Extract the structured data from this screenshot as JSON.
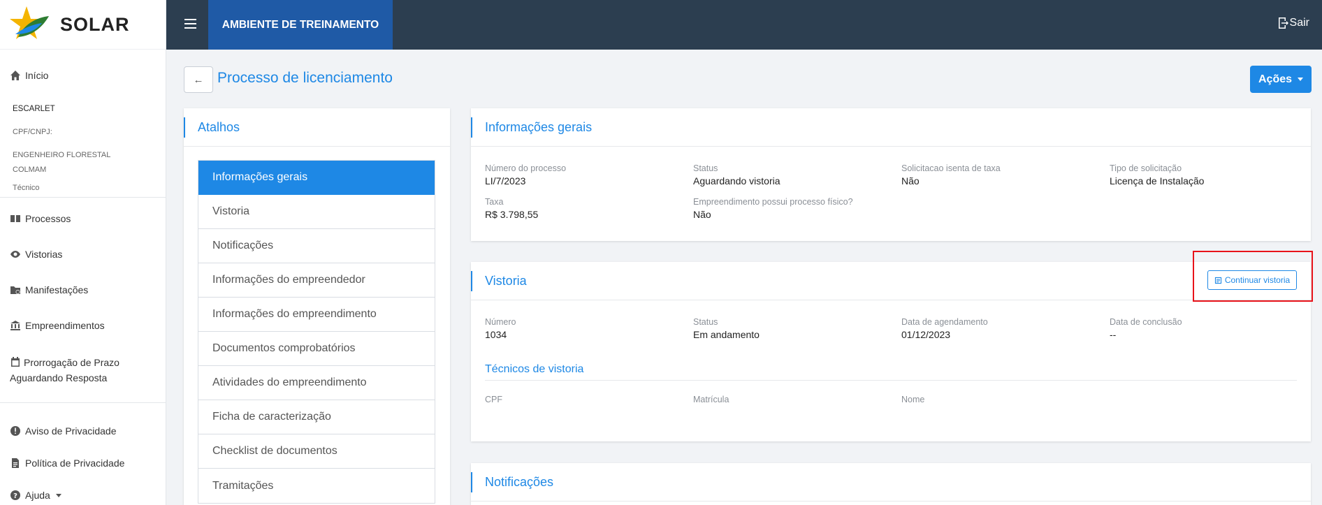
{
  "app": {
    "logo_text": "SOLAR"
  },
  "topbar": {
    "environment": "AMBIENTE DE TREINAMENTO",
    "logout_label": "Sair"
  },
  "sidebar": {
    "home": "Início",
    "user": {
      "name": "ESCARLET",
      "document": "CPF/CNPJ:",
      "role_line1": "ENGENHEIRO FLORESTAL",
      "role_line2": "COLMAM",
      "profile": "Técnico"
    },
    "items": [
      "Processos",
      "Vistorias",
      "Manifestações",
      "Empreendimentos"
    ],
    "extension_item": {
      "line1": "Prorrogação de Prazo",
      "line2": "Aguardando Resposta"
    },
    "footer": {
      "privacy_notice": "Aviso de Privacidade",
      "privacy_policy": "Política de Privacidade",
      "help": "Ajuda"
    }
  },
  "page": {
    "title": "Processo de licenciamento",
    "actions_label": "Ações"
  },
  "shortcuts": {
    "title": "Atalhos",
    "items": [
      "Informações gerais",
      "Vistoria",
      "Notificações",
      "Informações do empreendedor",
      "Informações do empreendimento",
      "Documentos comprobatórios",
      "Atividades do empreendimento",
      "Ficha de caracterização",
      "Checklist de documentos",
      "Tramitações"
    ],
    "active_index": 0
  },
  "general_info": {
    "title": "Informações gerais",
    "fields": [
      {
        "label": "Número do processo",
        "value": "LI/7/2023"
      },
      {
        "label": "Status",
        "value": "Aguardando vistoria"
      },
      {
        "label": "Solicitacao isenta de taxa",
        "value": "Não"
      },
      {
        "label": "Tipo de solicitação",
        "value": "Licença de Instalação"
      },
      {
        "label": "Taxa",
        "value": "R$ 3.798,55"
      },
      {
        "label": "Empreendimento possui processo físico?",
        "value": "Não"
      }
    ]
  },
  "inspection": {
    "title": "Vistoria",
    "continue_label": "Continuar vistoria",
    "fields": [
      {
        "label": "Número",
        "value": "1034"
      },
      {
        "label": "Status",
        "value": "Em andamento"
      },
      {
        "label": "Data de agendamento",
        "value": "01/12/2023"
      },
      {
        "label": "Data de conclusão",
        "value": "--"
      }
    ],
    "technicians_title": "Técnicos de vistoria",
    "technicians_columns": [
      "CPF",
      "Matrícula",
      "Nome"
    ]
  },
  "notifications": {
    "title": "Notificações"
  }
}
